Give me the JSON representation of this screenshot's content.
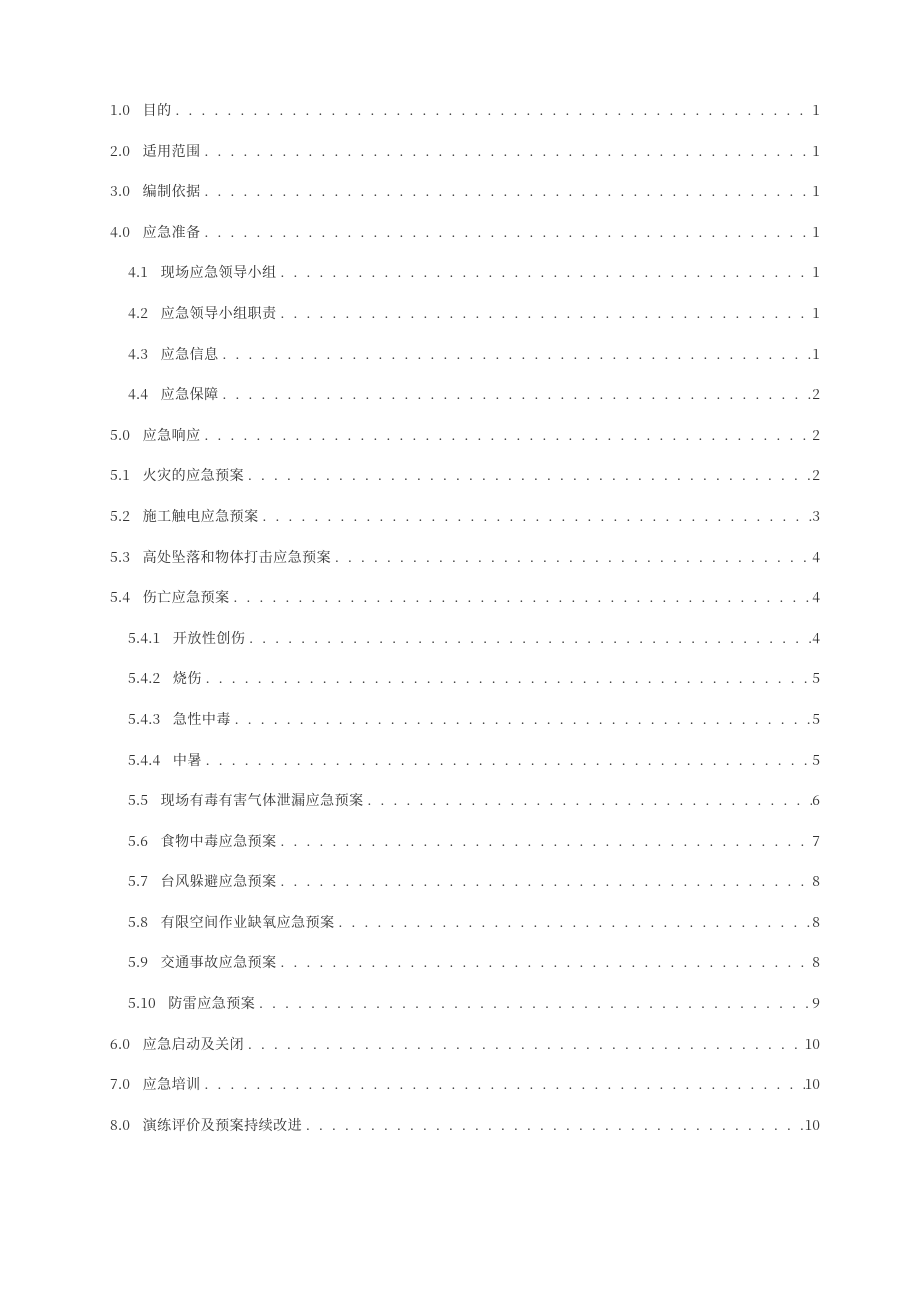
{
  "leader": ". . . . . . . . . . . . . . . . . . . . . . . . . . . . . . . . . . . . . . . . . . . . . . . . . . . . . . . . . . . . . . . . . . . . . . . . . . . . . . . . . . . . . . . . . . . . . . . . . . . . . . . . . . . . . . . . . . . . . . . . . . . . . . . . . . . . . . . . . . . . . . . . . . . .",
  "toc": [
    {
      "indent": 0,
      "num": "1.0",
      "title": "目的",
      "page": "1"
    },
    {
      "indent": 0,
      "num": "2.0",
      "title": "适用范围",
      "page": "1"
    },
    {
      "indent": 0,
      "num": "3.0",
      "title": "编制依据",
      "page": "1"
    },
    {
      "indent": 0,
      "num": "4.0",
      "title": "应急准备",
      "page": "1"
    },
    {
      "indent": 1,
      "num": "4.1",
      "title": "现场应急领导小组",
      "page": "1"
    },
    {
      "indent": 1,
      "num": "4.2",
      "title": "应急领导小组职责",
      "page": "1"
    },
    {
      "indent": 1,
      "num": "4.3",
      "title": "应急信息",
      "page": "1"
    },
    {
      "indent": 1,
      "num": "4.4",
      "title": "应急保障",
      "page": "2"
    },
    {
      "indent": 0,
      "num": "5.0",
      "title": "应急响应",
      "page": "2"
    },
    {
      "indent": 0,
      "num": "5.1",
      "title": "火灾的应急预案",
      "page": "2"
    },
    {
      "indent": 0,
      "num": "5.2",
      "title": "施工触电应急预案",
      "page": "3"
    },
    {
      "indent": 0,
      "num": "5.3",
      "title": "高处坠落和物体打击应急预案",
      "page": "4"
    },
    {
      "indent": 0,
      "num": "5.4",
      "title": "伤亡应急预案",
      "page": "4"
    },
    {
      "indent": 2,
      "num": "5.4.1",
      "title": "开放性创伤",
      "page": "4"
    },
    {
      "indent": 2,
      "num": "5.4.2",
      "title": "烧伤",
      "page": "5"
    },
    {
      "indent": 2,
      "num": "5.4.3",
      "title": "急性中毒",
      "page": "5"
    },
    {
      "indent": 2,
      "num": "5.4.4",
      "title": "中暑",
      "page": "5"
    },
    {
      "indent": 1,
      "num": "5.5",
      "title": "现场有毒有害气体泄漏应急预案",
      "page": "6"
    },
    {
      "indent": 1,
      "num": "5.6",
      "title": "食物中毒应急预案",
      "page": "7"
    },
    {
      "indent": 1,
      "num": "5.7",
      "title": "台风躲避应急预案",
      "page": "8"
    },
    {
      "indent": 1,
      "num": "5.8",
      "title": "有限空间作业缺氧应急预案",
      "page": "8"
    },
    {
      "indent": 1,
      "num": "5.9",
      "title": "交通事故应急预案",
      "page": "8"
    },
    {
      "indent": 1,
      "num": "5.10",
      "title": "防雷应急预案",
      "page": "9"
    },
    {
      "indent": 0,
      "num": "6.0",
      "title": "应急启动及关闭",
      "page": "10"
    },
    {
      "indent": 0,
      "num": "7.0",
      "title": "应急培训",
      "page": "10"
    },
    {
      "indent": 0,
      "num": "8.0",
      "title": "演练评价及预案持续改进",
      "page": "10"
    }
  ]
}
